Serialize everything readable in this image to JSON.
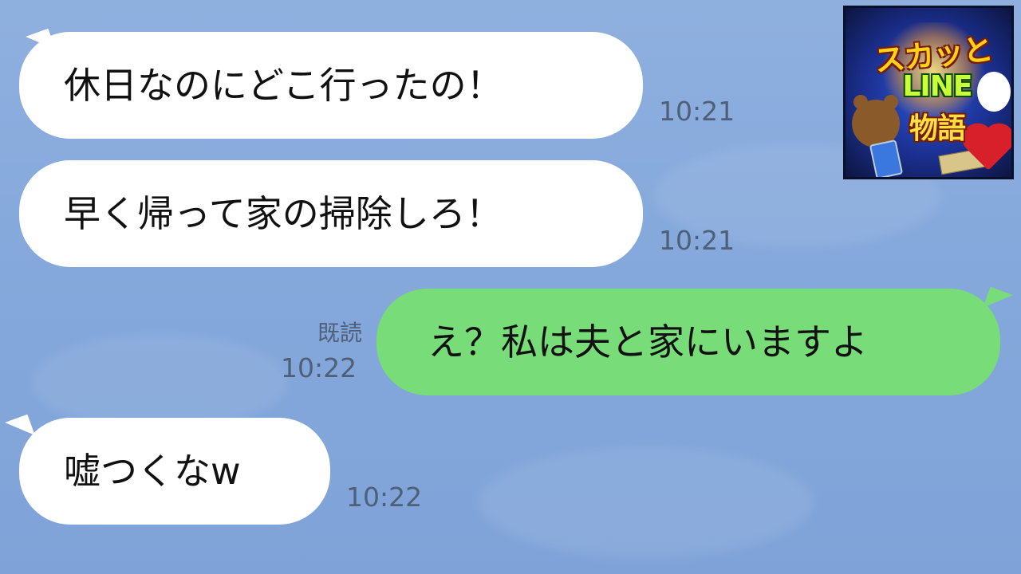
{
  "messages": [
    {
      "side": "in",
      "text": "休日なのにどこ行ったの！",
      "time": "10:21"
    },
    {
      "side": "in",
      "text": "早く帰って家の掃除しろ！",
      "time": "10:21"
    },
    {
      "side": "out",
      "text": "え？私は夫と家にいますよ",
      "time": "10:22",
      "read": "既読"
    },
    {
      "side": "in",
      "text": "嘘つくなw",
      "time": "10:22"
    }
  ],
  "logo": {
    "line1": "スカッと",
    "line2": "LINE",
    "line3": "物語"
  },
  "colors": {
    "background": "#86a9dc",
    "incoming_bubble": "#ffffff",
    "outgoing_bubble": "#78dc78",
    "timestamp": "#4e5f78"
  }
}
